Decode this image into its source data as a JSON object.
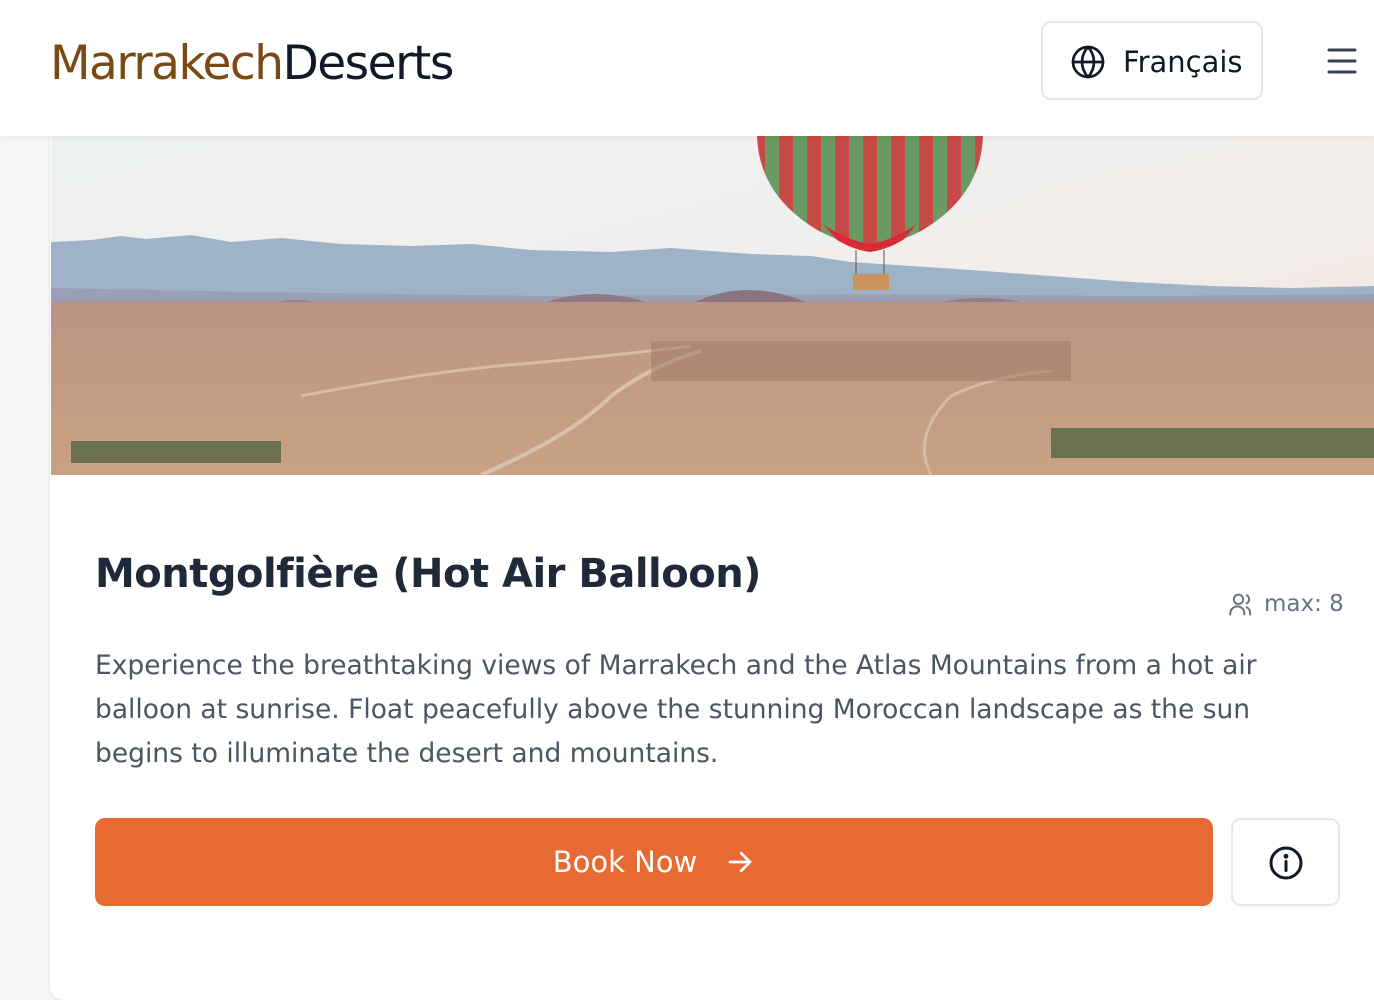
{
  "header": {
    "logo_part1": "Marrakech",
    "logo_part2": "Deserts",
    "language_label": "Français",
    "icons": {
      "language": "globe-icon",
      "menu": "hamburger-menu-icon"
    }
  },
  "activity": {
    "image_subject": "hot-air-balloon-over-desert",
    "title": "Montgolfière (Hot Air Balloon)",
    "capacity_label": "max: 8",
    "description": "Experience the breathtaking views of Marrakech and the Atlas Mountains from a hot air balloon at sunrise. Float peacefully above the stunning Moroccan landscape as the sun begins to illuminate the desert and mountains.",
    "book_label": "Book Now",
    "icons": {
      "capacity": "users-icon",
      "book": "arrow-right-icon",
      "info": "info-icon"
    }
  },
  "colors": {
    "brand_brown": "#7a4a14",
    "accent_orange": "#e86a33",
    "text_dark": "#1f2937",
    "text_muted": "#4b5563"
  }
}
